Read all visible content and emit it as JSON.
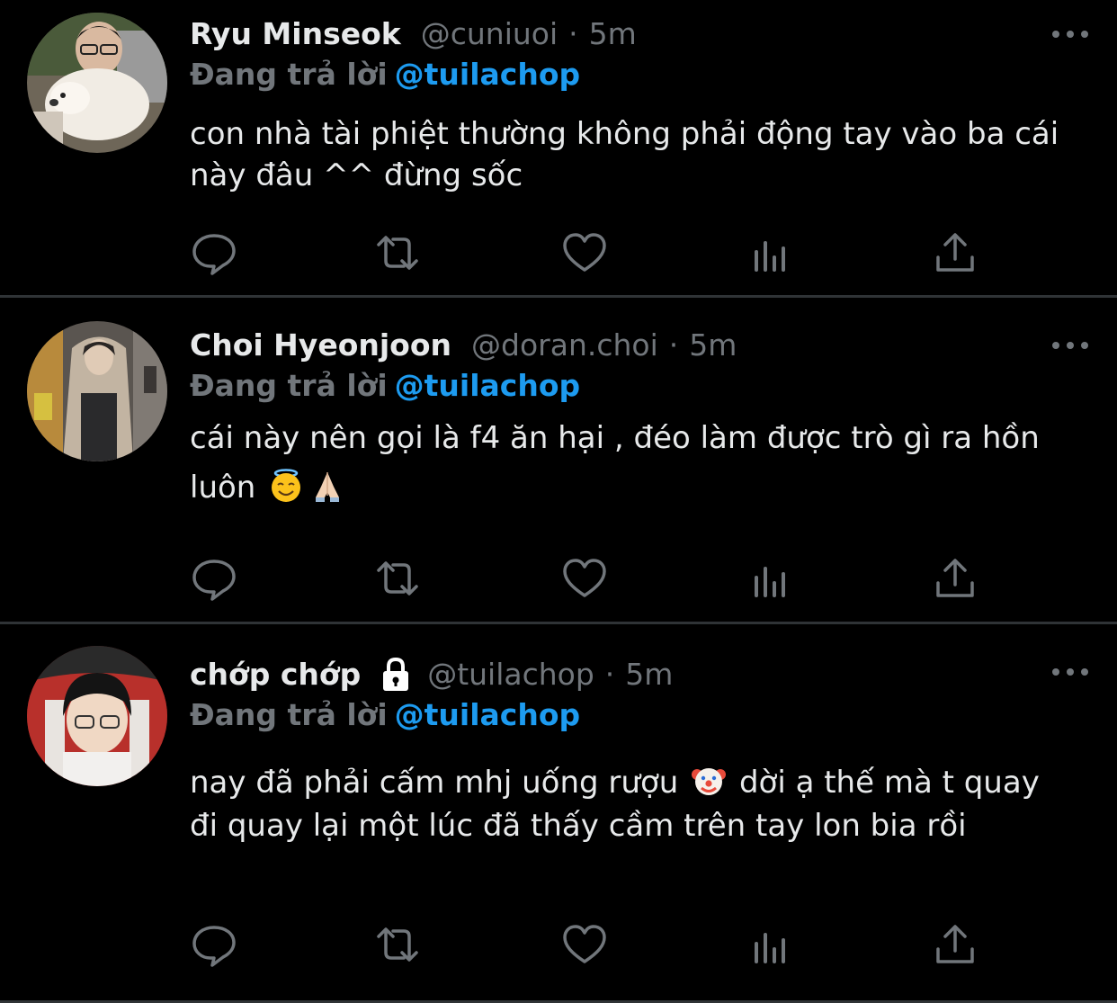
{
  "colors": {
    "background": "#000000",
    "text": "#e7e9ea",
    "secondary": "#71767b",
    "accent": "#1d9bf0",
    "divider": "#2f3336"
  },
  "tweets": [
    {
      "name": "Ryu Minseok",
      "handle": "@cuniuoi",
      "time": "5m",
      "reply_label": "Đang trả lời",
      "reply_to": "@tuilachop",
      "text_parts": [
        "con nhà tài phiệt thường không phải động tay vào ba cái này đâu ^^ đừng sốc"
      ]
    },
    {
      "name": "Choi Hyeonjoon",
      "handle": "@doran.choi",
      "time": "5m",
      "reply_label": "Đang trả lời",
      "reply_to": "@tuilachop",
      "text_parts": [
        "cái này nên gọi là f4 ăn hại , đéo làm được trò gì ra hồn luôn"
      ],
      "emojis": [
        "smiling-face-with-halo-emoji",
        "folded-hands-emoji"
      ]
    },
    {
      "name": "chớp chớp",
      "handle": "@tuilachop",
      "time": "5m",
      "reply_label": "Đang trả lời",
      "reply_to": "@tuilachop",
      "text_parts": [
        "nay đã phải cấm mhj uống rượu",
        "dời ạ thế mà t quay đi quay lại một lúc đã thấy cầm trên tay lon bia rồi"
      ],
      "emojis": [
        "clown-face-emoji"
      ],
      "protected": true
    }
  ],
  "dot_separator": "·",
  "icons": [
    "reply-icon",
    "retweet-icon",
    "like-icon",
    "analytics-icon",
    "share-icon",
    "more-icon",
    "lock-icon"
  ]
}
